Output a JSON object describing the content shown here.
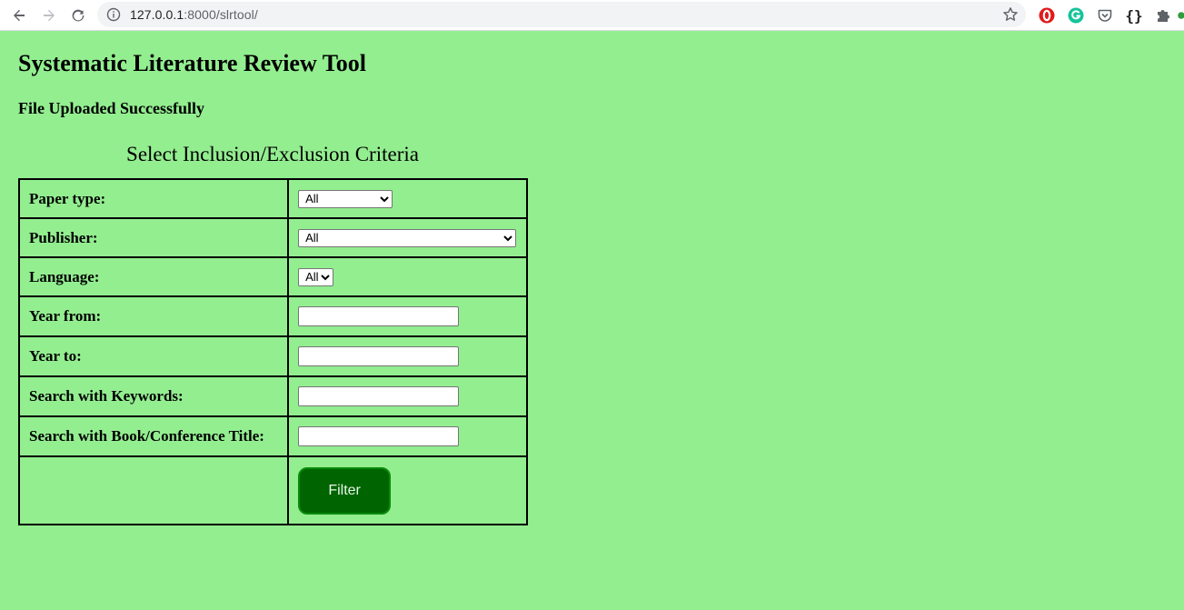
{
  "browser": {
    "url_host": "127.0.0.1",
    "url_path": ":8000/slrtool/"
  },
  "page": {
    "title": "Systematic Literature Review Tool",
    "status_message": "File Uploaded Successfully",
    "caption": "Select Inclusion/Exclusion Criteria"
  },
  "form": {
    "paper_type": {
      "label": "Paper type:",
      "selected": "All"
    },
    "publisher": {
      "label": "Publisher:",
      "selected": "All"
    },
    "language": {
      "label": "Language:",
      "selected": "All"
    },
    "year_from": {
      "label": "Year from:",
      "value": ""
    },
    "year_to": {
      "label": "Year to:",
      "value": ""
    },
    "keywords": {
      "label": "Search with Keywords:",
      "value": ""
    },
    "book_title": {
      "label": "Search with Book/Conference Title:",
      "value": ""
    },
    "filter_label": "Filter"
  },
  "icons": {
    "back": "arrow-left-icon",
    "forward": "arrow-right-icon",
    "reload": "reload-icon",
    "site_info": "info-icon",
    "bookmark": "star-icon",
    "extensions": [
      "opera-adblock-icon",
      "grammarly-icon",
      "pocket-icon",
      "json-formatter-icon",
      "puzzle-icon"
    ]
  },
  "colors": {
    "page_background": "#93ee90",
    "filter_button": "#006400"
  }
}
